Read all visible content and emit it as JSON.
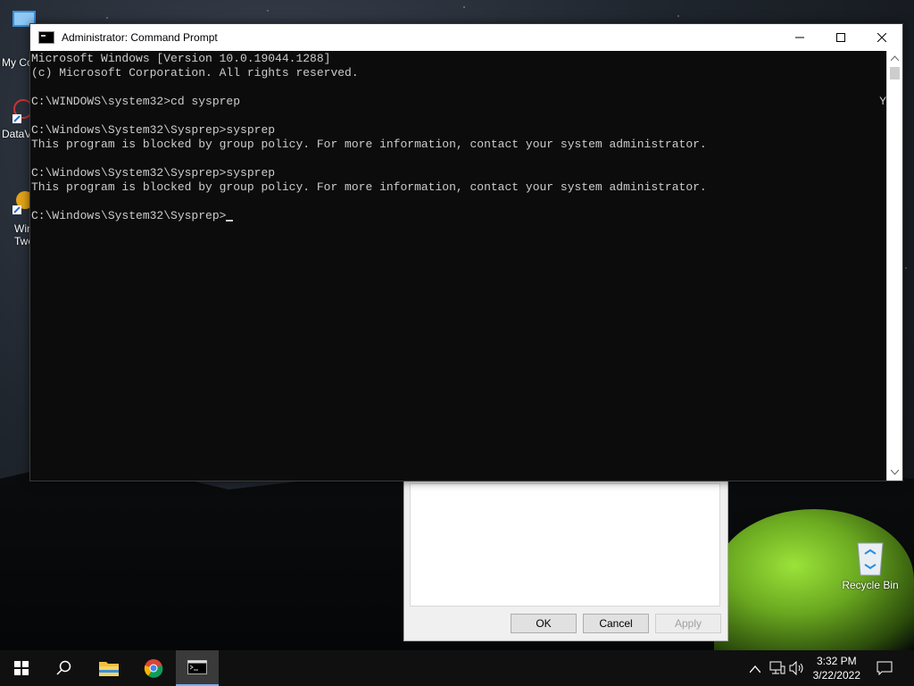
{
  "desktop": {
    "left_icons": [
      {
        "label": "My Co"
      },
      {
        "label": "DataV"
      },
      {
        "label": "Win Twe"
      }
    ],
    "recycle_bin_label": "Recycle Bin"
  },
  "background_dialog": {
    "ok_label": "OK",
    "cancel_label": "Cancel",
    "apply_label": "Apply"
  },
  "cmd_window": {
    "title": "Administrator: Command Prompt",
    "lines": [
      "Microsoft Windows [Version 10.0.19044.1288]",
      "(c) Microsoft Corporation. All rights reserved.",
      "",
      "C:\\WINDOWS\\system32>cd sysprep",
      "",
      "C:\\Windows\\System32\\Sysprep>sysprep",
      "This program is blocked by group policy. For more information, contact your system administrator.",
      "",
      "C:\\Windows\\System32\\Sysprep>sysprep",
      "This program is blocked by group policy. For more information, contact your system administrator.",
      ""
    ],
    "prompt": "C:\\Windows\\System32\\Sysprep>",
    "edge_char": "Y"
  },
  "taskbar": {
    "items": [
      {
        "name": "start",
        "icon": "windows-logo"
      },
      {
        "name": "search",
        "icon": "search-icon"
      },
      {
        "name": "file-explorer",
        "icon": "folder-icon"
      },
      {
        "name": "chrome",
        "icon": "chrome-icon"
      },
      {
        "name": "command-prompt",
        "icon": "terminal-icon",
        "active": true
      }
    ],
    "clock_time": "3:32 PM",
    "clock_date": "3/22/2022"
  }
}
